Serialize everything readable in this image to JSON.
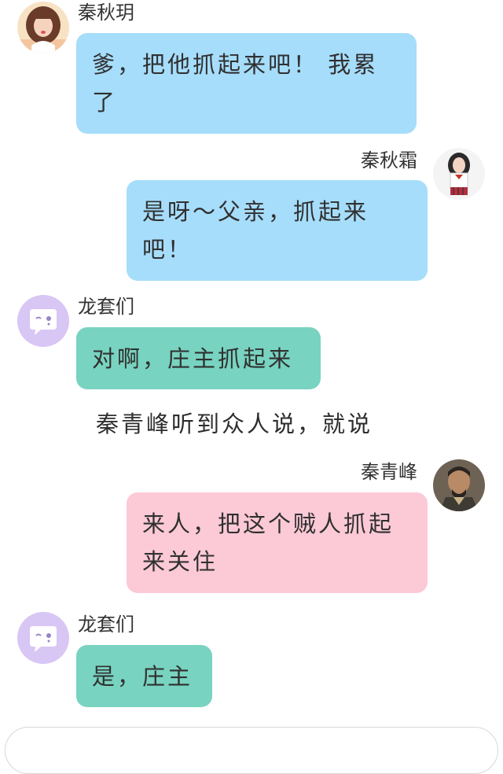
{
  "messages": [
    {
      "sender": "秦秋玥",
      "text": "爹，把他抓起来吧！ 我累了",
      "side": "left",
      "avatar": "girl-photo-avatar",
      "bubble_color": "#a6ddfb"
    },
    {
      "sender": "秦秋霜",
      "text": "是呀～父亲，抓起来吧！",
      "side": "right",
      "avatar": "schoolgirl-photo-avatar",
      "bubble_color": "#a6ddfb"
    },
    {
      "sender": "龙套们",
      "text": "对啊，庄主抓起来",
      "side": "left",
      "avatar": "chat-bubble-face-icon",
      "bubble_color": "#78d3c0"
    },
    {
      "sender": "秦青峰",
      "text": "来人，把这个贼人抓起来关住",
      "side": "right",
      "avatar": "man-portrait-avatar",
      "bubble_color": "#fcc9d7"
    },
    {
      "sender": "龙套们",
      "text": "是，庄主",
      "side": "left",
      "avatar": "chat-bubble-face-icon",
      "bubble_color": "#78d3c0"
    }
  ],
  "narration": "秦青峰听到众人说，就说",
  "colors": {
    "blue_bubble": "#a6ddfb",
    "teal_bubble": "#78d3c0",
    "pink_bubble": "#fcc9d7",
    "placeholder_avatar_bg": "#d8c6f5"
  }
}
